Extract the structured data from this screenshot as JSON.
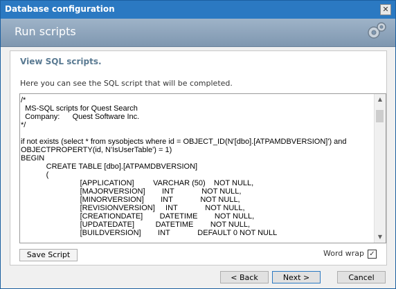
{
  "window": {
    "title": "Database configuration",
    "close_label": "✕"
  },
  "banner": {
    "title": "Run scripts",
    "icon": "gears-icon"
  },
  "content": {
    "heading": "View SQL scripts.",
    "description": "Here you can see the SQL script that will be completed.",
    "script_lines": [
      "/*",
      "  MS-SQL scripts for Quest Search",
      "  Company:      Quest Software Inc.",
      "*/",
      "",
      "if not exists (select * from sysobjects where id = OBJECT_ID(N'[dbo].[ATPAMDBVERSION]') and",
      "OBJECTPROPERTY(id, N'IsUserTable') = 1)",
      "BEGIN",
      "            CREATE TABLE [dbo].[ATPAMDBVERSION]",
      "            (",
      "                            [APPLICATION]         VARCHAR (50)    NOT NULL,",
      "                            [MAJORVERSION]        INT             NOT NULL,",
      "                            [MINORVERSION]        INT             NOT NULL,",
      "                            [REVISIONVERSION]     INT             NOT NULL,",
      "                            [CREATIONDATE]        DATETIME        NOT NULL,",
      "                            [UPDATEDATE]          DATETIME        NOT NULL,",
      "                            [BUILDVERSION]        INT             DEFAULT 0 NOT NULL"
    ],
    "save_script_label": "Save Script",
    "word_wrap_label": "Word wrap",
    "word_wrap_checked": true
  },
  "footer": {
    "back_label": "< Back",
    "next_label": "Next >",
    "cancel_label": "Cancel"
  }
}
